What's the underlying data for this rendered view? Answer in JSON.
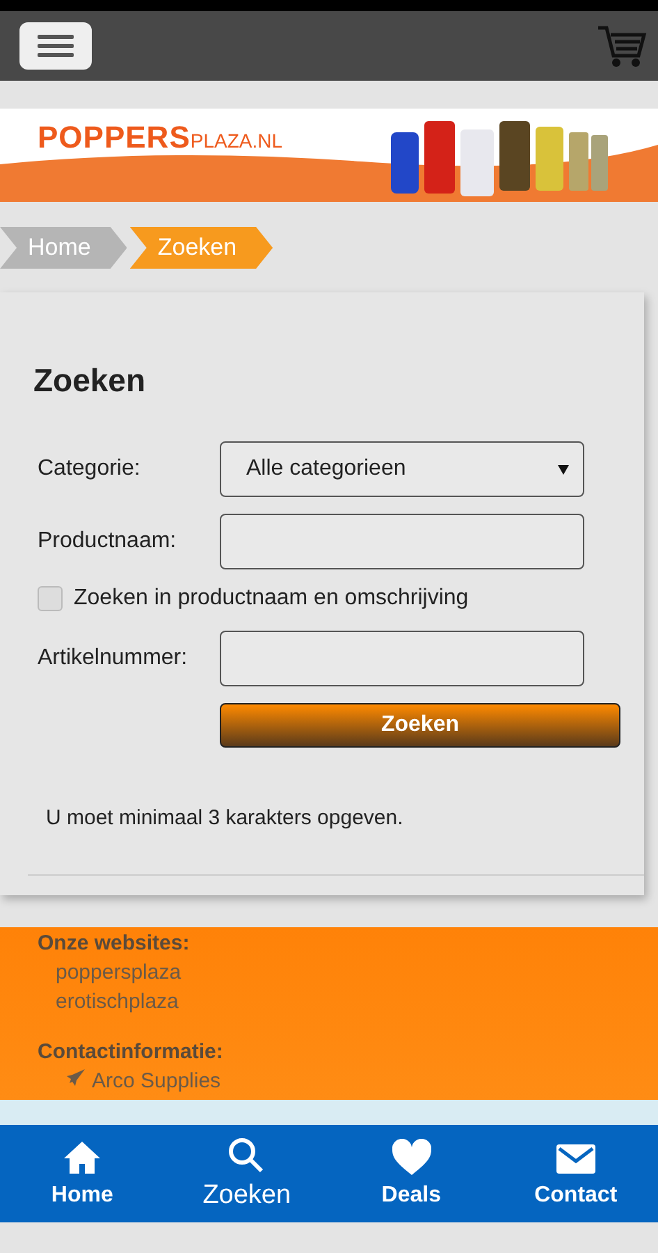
{
  "banner": {
    "logo_main": "POPPERS",
    "logo_suffix": "PLAZA.NL"
  },
  "breadcrumb": [
    {
      "label": "Home",
      "selected": false
    },
    {
      "label": "Zoeken",
      "selected": true
    }
  ],
  "form": {
    "title": "Zoeken",
    "fields": [
      {
        "kind": "select",
        "label": "Categorie:",
        "value": "Alle categorieen"
      },
      {
        "kind": "text",
        "label": "Productnaam:"
      },
      {
        "kind": "checkbox",
        "label": "Zoeken in productnaam en omschrijving",
        "checked": false
      },
      {
        "kind": "text",
        "label": "Artikelnummer:"
      }
    ],
    "submit": "Zoeken",
    "message": "U moet minimaal 3 karakters opgeven."
  },
  "footer": {
    "sections": [
      {
        "title": "Onze websites:",
        "links": [
          {
            "label": "poppersplaza",
            "kind": "link"
          },
          {
            "label": "erotischplaza",
            "kind": "link"
          }
        ]
      },
      {
        "title": "Contactinformatie:",
        "links": [
          {
            "label": "Arco Supplies",
            "kind": "address"
          }
        ]
      }
    ]
  },
  "nav": [
    {
      "label": "Home",
      "selected": false
    },
    {
      "label": "Zoeken",
      "selected": true
    },
    {
      "label": "Deals",
      "selected": false
    },
    {
      "label": "Contact",
      "selected": false
    }
  ]
}
